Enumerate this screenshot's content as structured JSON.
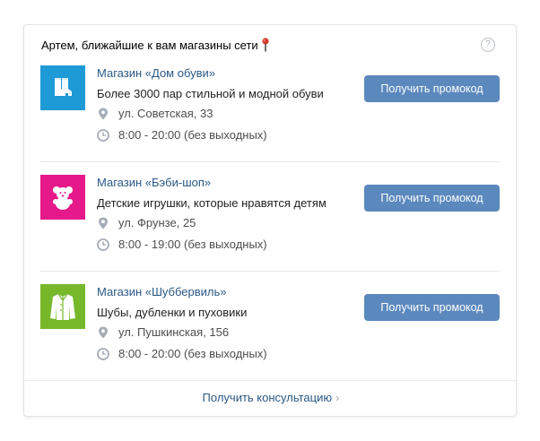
{
  "header": {
    "title": "Артем, ближайшие к вам магазины сети",
    "pin_icon": "location-pin-icon",
    "help_icon": "help-icon",
    "help_glyph": "?"
  },
  "stores": [
    {
      "name": "Магазин «Дом обуви»",
      "description": "Более 3000 пар стильной и модной обуви",
      "address": "ул. Советская, 33",
      "hours": "8:00 - 20:00 (без выходных)",
      "button": "Получить промокод",
      "logo_icon": "boots-icon",
      "logo_color": "#1e9ad6"
    },
    {
      "name": "Магазин «Бэби-шоп»",
      "description": "Детские игрушки, которые нравятся детям",
      "address": "ул. Фрунзе, 25",
      "hours": "8:00 - 19:00 (без выходных)",
      "button": "Получить промокод",
      "logo_icon": "teddy-bear-icon",
      "logo_color": "#e6198a"
    },
    {
      "name": "Магазин «Шуббервиль»",
      "description": "Шубы, дубленки и пуховики",
      "address": "ул. Пушкинская, 156",
      "hours": "8:00 - 20:00 (без выходных)",
      "button": "Получить промокод",
      "logo_icon": "coat-icon",
      "logo_color": "#76b82a"
    }
  ],
  "footer": {
    "consult_label": "Получить консультацию",
    "chevron": "›"
  },
  "colors": {
    "accent_button": "#5b88bd",
    "link": "#2a5885"
  }
}
